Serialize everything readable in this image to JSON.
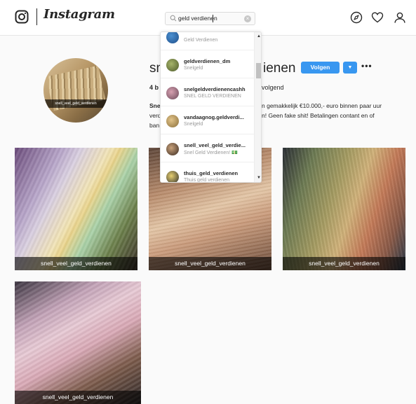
{
  "header": {
    "brand": "Instagram",
    "search": {
      "value": "geld verdienen"
    },
    "icons": [
      "instagram-glyph-icon",
      "compass-icon",
      "heart-icon",
      "profile-icon"
    ]
  },
  "profile": {
    "username_visible_start": "sn",
    "username_visible_end": "ienen",
    "follow_label": "Volgen",
    "more_label": "•••",
    "stats": {
      "posts_visible": "4 b",
      "following_visible": "volgend"
    },
    "bio": {
      "line1_start": "Sne",
      "line1_end": "n gemakkelijk €10.000,- euro binnen paar uur",
      "line2_start": "verd",
      "line2_end": "n! Geen fake shit! Betalingen contant en of",
      "line3_start": "ban"
    },
    "avatar_caption": "snell_veel_geld_verdienen"
  },
  "search_results": [
    {
      "name": "",
      "subtitle": "Geld Verdienen"
    },
    {
      "name": "geldverdienen_dm",
      "subtitle": "Snelgeld"
    },
    {
      "name": "snelgeldverdienencashh",
      "subtitle": "SNEL GELD VERDIENEN"
    },
    {
      "name": "vandaagnog.geldverdi...",
      "subtitle": "Snelgeld"
    },
    {
      "name": "snell_veel_geld_verdie...",
      "subtitle": "Snel Geld Verdienen! 💵"
    },
    {
      "name": "thuis_geld_verdienen",
      "subtitle": "Thuis geld verdienen"
    }
  ],
  "posts": [
    {
      "caption": "snell_veel_geld_verdienen"
    },
    {
      "caption": "snell_veel_geld_verdienen"
    },
    {
      "caption": "snell_veel_geld_verdienen"
    },
    {
      "caption": "snell_veel_geld_verdienen"
    }
  ],
  "colors": {
    "accent": "#3897f0",
    "text": "#262626",
    "muted": "#999999",
    "background": "#fafafa"
  }
}
